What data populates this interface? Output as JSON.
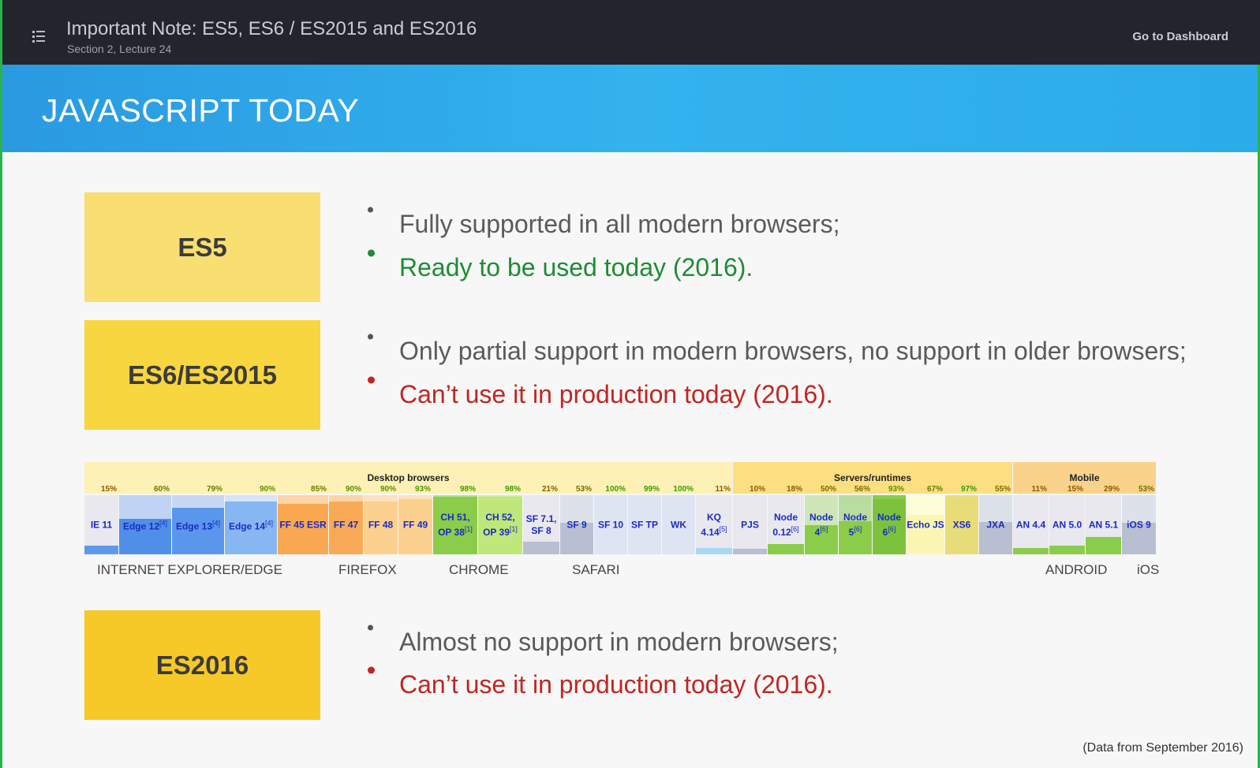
{
  "header": {
    "title": "Important Note: ES5, ES6 / ES2015 and ES2016",
    "subtitle": "Section 2, Lecture 24",
    "dashboard_link": "Go to Dashboard",
    "menu_icon": "list-icon"
  },
  "slide": {
    "banner_title": "JAVASCRIPT TODAY",
    "sections": [
      {
        "label": "ES5",
        "box_color": "#f9df72",
        "bullets": [
          {
            "text": "Fully supported in all modern browsers;",
            "style": "gray"
          },
          {
            "text": "Ready to be used today (2016).",
            "style": "green"
          }
        ]
      },
      {
        "label": "ES6/ES2015",
        "box_color": "#f7d63f",
        "bullets": [
          {
            "text": "Only partial support in modern browsers, no support in older browsers;",
            "style": "gray"
          },
          {
            "text": "Can’t use it in production today (2016).",
            "style": "red"
          }
        ]
      },
      {
        "label": "ES2016",
        "box_color": "#f6c928",
        "bullets": [
          {
            "text": "Almost no support in modern browsers;",
            "style": "gray"
          },
          {
            "text": "Can’t use it in production today (2016).",
            "style": "red"
          }
        ]
      }
    ],
    "footnote": "(Data from September 2016)"
  },
  "compat_table": {
    "groups": [
      {
        "label": "Desktop browsers",
        "color": "#fdf1b5",
        "cells": 19
      },
      {
        "label": "Servers/runtimes",
        "color": "#fbdf80",
        "cells": 8
      },
      {
        "label": "Mobile",
        "color": "#fbd28c",
        "cells": 4
      }
    ],
    "browsers": [
      {
        "name": "IE 11",
        "pct": "15%",
        "support": 0.15,
        "bg": "#e8e8ee",
        "fill": "#5d9aeb",
        "pct_color": "#8a5a00"
      },
      {
        "name": "Edge 12",
        "sup": "[4]",
        "pct": "60%",
        "support": 0.6,
        "bg": "#c0d3f2",
        "fill": "#4f8fe8",
        "pct_color": "#6a7a00"
      },
      {
        "name": "Edge 13",
        "sup": "[4]",
        "pct": "79%",
        "support": 0.79,
        "bg": "#c8d8f3",
        "fill": "#5a97ec",
        "pct_color": "#6a7a00"
      },
      {
        "name": "Edge 14",
        "sup": "[4]",
        "pct": "90%",
        "support": 0.9,
        "bg": "#d6e4f7",
        "fill": "#86b7f3",
        "pct_color": "#5a9000"
      },
      {
        "name": "FF 45 ESR",
        "pct": "85%",
        "support": 0.85,
        "bg": "#fbd4a8",
        "fill": "#f9a851",
        "pct_color": "#6a7a00"
      },
      {
        "name": "FF 47",
        "pct": "90%",
        "support": 0.9,
        "bg": "#fbd4a8",
        "fill": "#f9aa56",
        "pct_color": "#5a9000"
      },
      {
        "name": "FF 48",
        "pct": "90%",
        "support": 0.9,
        "bg": "#fde2bf",
        "fill": "#fcd08e",
        "pct_color": "#5a9000"
      },
      {
        "name": "FF 49",
        "pct": "93%",
        "support": 0.93,
        "bg": "#fde2bf",
        "fill": "#fcd08e",
        "pct_color": "#5a9000"
      },
      {
        "name": "CH 51, OP 38",
        "sup": "[1]",
        "pct": "98%",
        "support": 0.98,
        "bg": "#b8e28f",
        "fill": "#8bcc4a",
        "pct_color": "#3a9a00"
      },
      {
        "name": "CH 52, OP 39",
        "sup": "[1]",
        "pct": "98%",
        "support": 0.98,
        "bg": "#d4ef9f",
        "fill": "#bfe77a",
        "pct_color": "#3a9a00"
      },
      {
        "name": "SF 7.1, SF 8",
        "pct": "21%",
        "support": 0.21,
        "bg": "#e8e8ee",
        "fill": "#b7bfd0",
        "pct_color": "#8a5a00"
      },
      {
        "name": "SF 9",
        "pct": "53%",
        "support": 0.53,
        "bg": "#dde1ea",
        "fill": "#b7bfd0",
        "pct_color": "#7a6a00"
      },
      {
        "name": "SF 10",
        "pct": "100%",
        "support": 1.0,
        "bg": "#dfe4f2",
        "fill": "#dfe4f2",
        "pct_color": "#3a9a00"
      },
      {
        "name": "SF TP",
        "pct": "99%",
        "support": 0.99,
        "bg": "#dfe4f2",
        "fill": "#dfe4f2",
        "pct_color": "#3a9a00"
      },
      {
        "name": "WK",
        "pct": "100%",
        "support": 1.0,
        "bg": "#dfe4f2",
        "fill": "#dfe4f2",
        "pct_color": "#3a9a00"
      },
      {
        "name": "KQ 4.14",
        "sup": "[5]",
        "pct": "11%",
        "support": 0.11,
        "bg": "#e8e8ee",
        "fill": "#a9d8f5",
        "pct_color": "#8a5a00"
      },
      {
        "name": "PJS",
        "pct": "10%",
        "support": 0.1,
        "bg": "#e8e8ee",
        "fill": "#b7bfd0",
        "pct_color": "#8a5a00"
      },
      {
        "name": "Node 0.12",
        "sup": "[6]",
        "pct": "18%",
        "support": 0.18,
        "bg": "#e8e8ee",
        "fill": "#8bcc4a",
        "pct_color": "#8a5a00"
      },
      {
        "name": "Node 4",
        "sup": "[6]",
        "pct": "50%",
        "support": 0.5,
        "bg": "#cfe6b9",
        "fill": "#8bcc4a",
        "pct_color": "#7a6a00"
      },
      {
        "name": "Node 5",
        "sup": "[6]",
        "pct": "56%",
        "support": 0.56,
        "bg": "#b9dda0",
        "fill": "#8bcc4a",
        "pct_color": "#7a6a00"
      },
      {
        "name": "Node 6",
        "sup": "[6]",
        "pct": "93%",
        "support": 0.93,
        "bg": "#8bcc4a",
        "fill": "#7dc23d",
        "pct_color": "#5a9000"
      },
      {
        "name": "Echo JS",
        "pct": "67%",
        "support": 0.67,
        "bg": "#fdfdd8",
        "fill": "#fbf7b3",
        "pct_color": "#6a7a00"
      },
      {
        "name": "XS6",
        "pct": "97%",
        "support": 0.97,
        "bg": "#ebe17e",
        "fill": "#e8dc78",
        "pct_color": "#3a9a00"
      },
      {
        "name": "JXA",
        "pct": "55%",
        "support": 0.55,
        "bg": "#dde1ea",
        "fill": "#b7bfd0",
        "pct_color": "#7a6a00"
      },
      {
        "name": "AN 4.4",
        "pct": "11%",
        "support": 0.11,
        "bg": "#e8e8ee",
        "fill": "#8bcc4a",
        "pct_color": "#8a5a00"
      },
      {
        "name": "AN 5.0",
        "pct": "15%",
        "support": 0.15,
        "bg": "#e8e8ee",
        "fill": "#8bcc4a",
        "pct_color": "#8a5a00"
      },
      {
        "name": "AN 5.1",
        "pct": "29%",
        "support": 0.29,
        "bg": "#e8e8ee",
        "fill": "#8bcc4a",
        "pct_color": "#8a5a00"
      },
      {
        "name": "iOS 9",
        "pct": "53%",
        "support": 0.53,
        "bg": "#dde1ea",
        "fill": "#b7bfd0",
        "pct_color": "#7a6a00"
      }
    ],
    "vendors": [
      {
        "label": "INTERNET EXPLORER/EDGE"
      },
      {
        "label": "FIREFOX"
      },
      {
        "label": "CHROME"
      },
      {
        "label": "SAFARI"
      },
      {
        "label": "ANDROID"
      },
      {
        "label": "iOS"
      }
    ]
  }
}
